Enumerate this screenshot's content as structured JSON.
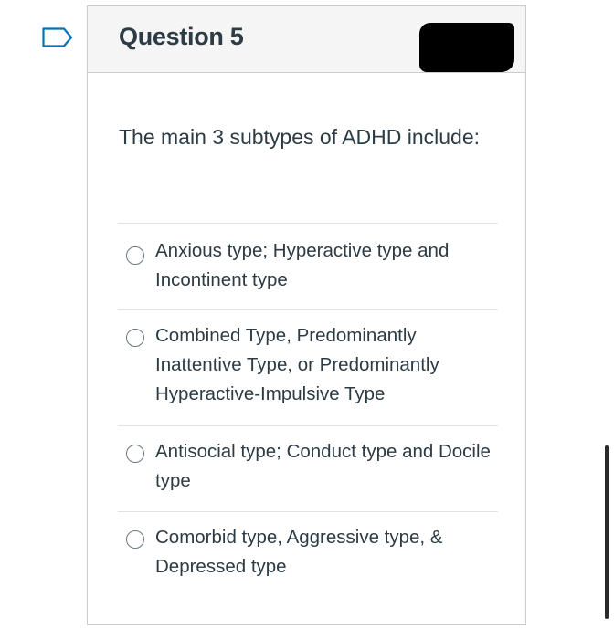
{
  "question": {
    "title": "Question 5",
    "text": "The main 3 subtypes of ADHD include:",
    "flag_icon": "bookmark-flag-icon"
  },
  "answers": [
    {
      "label": "Anxious type; Hyperactive type and Incontinent type",
      "selected": false
    },
    {
      "label": "Combined Type, Predominantly Inattentive Type, or Predominantly Hyperactive-Impulsive Type",
      "selected": false
    },
    {
      "label": "Antisocial type; Conduct type and Docile type",
      "selected": false
    },
    {
      "label": "Comorbid type, Aggressive type, & Depressed type",
      "selected": false
    }
  ],
  "colors": {
    "text": "#2d3b45",
    "header_bg": "#f5f5f5",
    "border": "#c7cdd1",
    "flag_outline": "#0374b5"
  }
}
